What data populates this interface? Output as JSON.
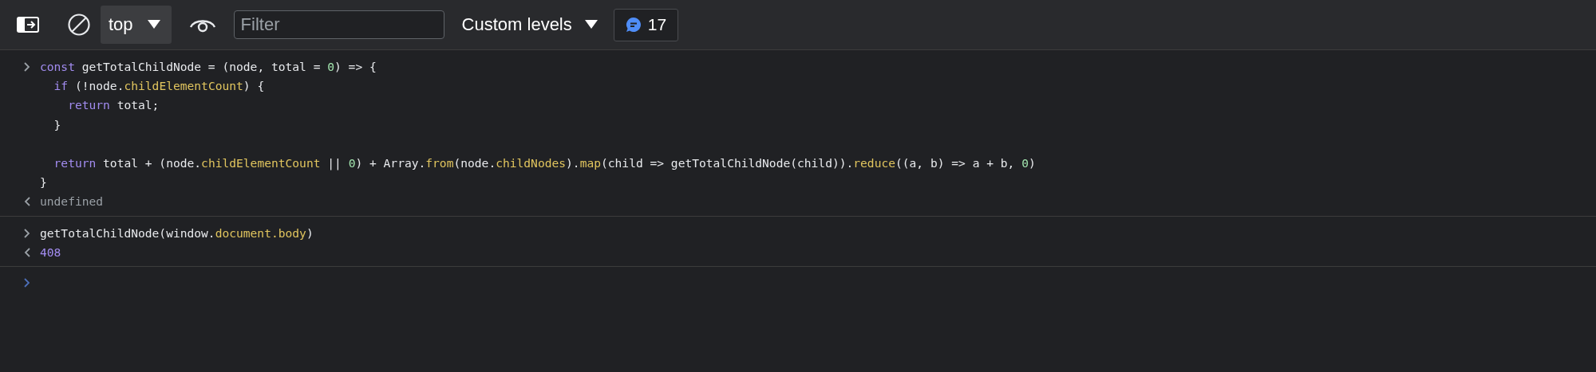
{
  "toolbar": {
    "context": {
      "label": "top"
    },
    "filter": {
      "placeholder": "Filter"
    },
    "levels": {
      "label": "Custom levels"
    },
    "issues": {
      "count": "17"
    }
  },
  "console": {
    "groups": [
      {
        "input": {
          "blocks": [
            {
              "lines": [
                {
                  "tokens": [
                    {
                      "kind": "keyword",
                      "text": "const"
                    },
                    {
                      "kind": "text",
                      "text": " getTotalChildNode = (node, total = "
                    },
                    {
                      "kind": "number",
                      "text": "0"
                    },
                    {
                      "kind": "text",
                      "text": ") => {"
                    }
                  ]
                },
                {
                  "tokens": [
                    {
                      "kind": "keyword",
                      "text": "  if"
                    },
                    {
                      "kind": "text",
                      "text": " (!node."
                    },
                    {
                      "kind": "property",
                      "text": "childElementCount"
                    },
                    {
                      "kind": "text",
                      "text": ") {"
                    }
                  ]
                },
                {
                  "tokens": [
                    {
                      "kind": "keyword",
                      "text": "    return"
                    },
                    {
                      "kind": "text",
                      "text": " total;"
                    }
                  ]
                },
                {
                  "tokens": [
                    {
                      "kind": "text",
                      "text": "  }"
                    }
                  ]
                }
              ]
            },
            {
              "lines": [
                {
                  "tokens": [
                    {
                      "kind": "keyword",
                      "text": "  return"
                    },
                    {
                      "kind": "text",
                      "text": " total + (node."
                    },
                    {
                      "kind": "property",
                      "text": "childElementCount"
                    },
                    {
                      "kind": "text",
                      "text": " || "
                    },
                    {
                      "kind": "number",
                      "text": "0"
                    },
                    {
                      "kind": "text",
                      "text": ") + Array."
                    },
                    {
                      "kind": "property",
                      "text": "from"
                    },
                    {
                      "kind": "text",
                      "text": "(node."
                    },
                    {
                      "kind": "property",
                      "text": "childNodes"
                    },
                    {
                      "kind": "text",
                      "text": ")."
                    },
                    {
                      "kind": "property",
                      "text": "map"
                    },
                    {
                      "kind": "text",
                      "text": "(child => getTotalChildNode(child))."
                    },
                    {
                      "kind": "property",
                      "text": "reduce"
                    },
                    {
                      "kind": "text",
                      "text": "((a, b) => a + b, "
                    },
                    {
                      "kind": "number",
                      "text": "0"
                    },
                    {
                      "kind": "text",
                      "text": ")"
                    }
                  ]
                },
                {
                  "tokens": [
                    {
                      "kind": "text",
                      "text": "}"
                    }
                  ]
                }
              ]
            }
          ]
        },
        "output": {
          "kind": "undefined",
          "text": "undefined"
        }
      },
      {
        "input": {
          "blocks": [
            {
              "lines": [
                {
                  "tokens": [
                    {
                      "kind": "text",
                      "text": "getTotalChildNode(window."
                    },
                    {
                      "kind": "property",
                      "text": "document"
                    },
                    {
                      "kind": "property",
                      "text": ".body"
                    },
                    {
                      "kind": "text",
                      "text": ")"
                    }
                  ]
                }
              ]
            }
          ]
        },
        "output": {
          "kind": "number",
          "text": "408"
        }
      }
    ]
  }
}
